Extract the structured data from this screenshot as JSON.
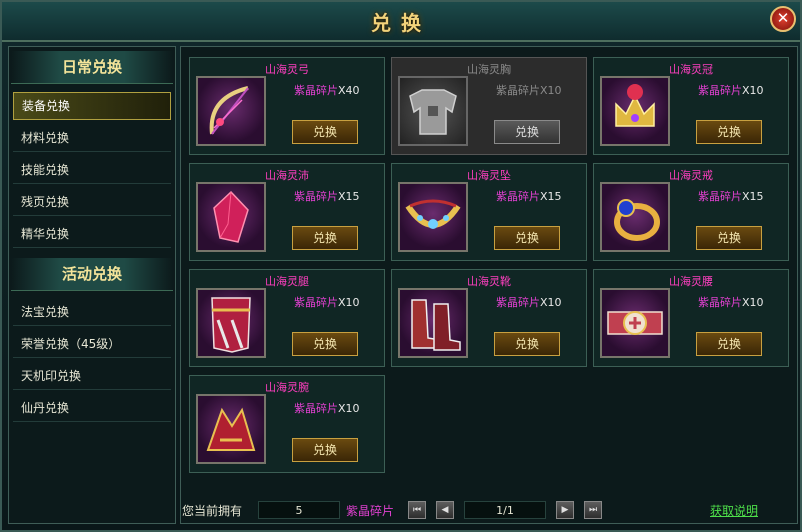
{
  "window": {
    "title": "兑换",
    "close_label": "✕"
  },
  "sidebar": {
    "sections": [
      {
        "title": "日常兑换",
        "items": [
          "装备兑换",
          "材料兑换",
          "技能兑换",
          "残页兑换",
          "精华兑换"
        ]
      },
      {
        "title": "活动兑换",
        "items": [
          "法宝兑换",
          "荣誉兑换（45级）",
          "天机印兑换",
          "仙丹兑换"
        ]
      }
    ],
    "active_item": "装备兑换"
  },
  "items": [
    {
      "name": "山海灵弓",
      "currency": "紫晶碎片",
      "qty": "X40",
      "button": "兑换",
      "disabled": false,
      "icon": "bow-icon"
    },
    {
      "name": "山海灵胸",
      "currency": "紫晶碎片",
      "qty": "X10",
      "button": "兑换",
      "disabled": true,
      "icon": "chest-armor-icon"
    },
    {
      "name": "山海灵冠",
      "currency": "紫晶碎片",
      "qty": "X10",
      "button": "兑换",
      "disabled": false,
      "icon": "crown-icon"
    },
    {
      "name": "山海灵沛",
      "currency": "紫晶碎片",
      "qty": "X15",
      "button": "兑换",
      "disabled": false,
      "icon": "crystal-icon"
    },
    {
      "name": "山海灵坠",
      "currency": "紫晶碎片",
      "qty": "X15",
      "button": "兑换",
      "disabled": false,
      "icon": "necklace-icon"
    },
    {
      "name": "山海灵戒",
      "currency": "紫晶碎片",
      "qty": "X15",
      "button": "兑换",
      "disabled": false,
      "icon": "ring-icon"
    },
    {
      "name": "山海灵腿",
      "currency": "紫晶碎片",
      "qty": "X10",
      "button": "兑换",
      "disabled": false,
      "icon": "leg-armor-icon"
    },
    {
      "name": "山海灵靴",
      "currency": "紫晶碎片",
      "qty": "X10",
      "button": "兑换",
      "disabled": false,
      "icon": "boots-icon"
    },
    {
      "name": "山海灵腰",
      "currency": "紫晶碎片",
      "qty": "X10",
      "button": "兑换",
      "disabled": false,
      "icon": "belt-icon"
    },
    {
      "name": "山海灵腕",
      "currency": "紫晶碎片",
      "qty": "X10",
      "button": "兑换",
      "disabled": false,
      "icon": "bracer-icon"
    }
  ],
  "footer": {
    "own_label": "您当前拥有",
    "own_value": "5",
    "own_currency": "紫晶碎片",
    "first_label": "⏮",
    "prev_label": "◀",
    "page": "1/1",
    "next_label": "▶",
    "last_label": "⏭",
    "help_link": "获取说明"
  },
  "colors": {
    "accent": "#f4e49a",
    "item_name": "#ff3fc0",
    "link": "#4ee04a",
    "button_border": "#c8a040"
  }
}
